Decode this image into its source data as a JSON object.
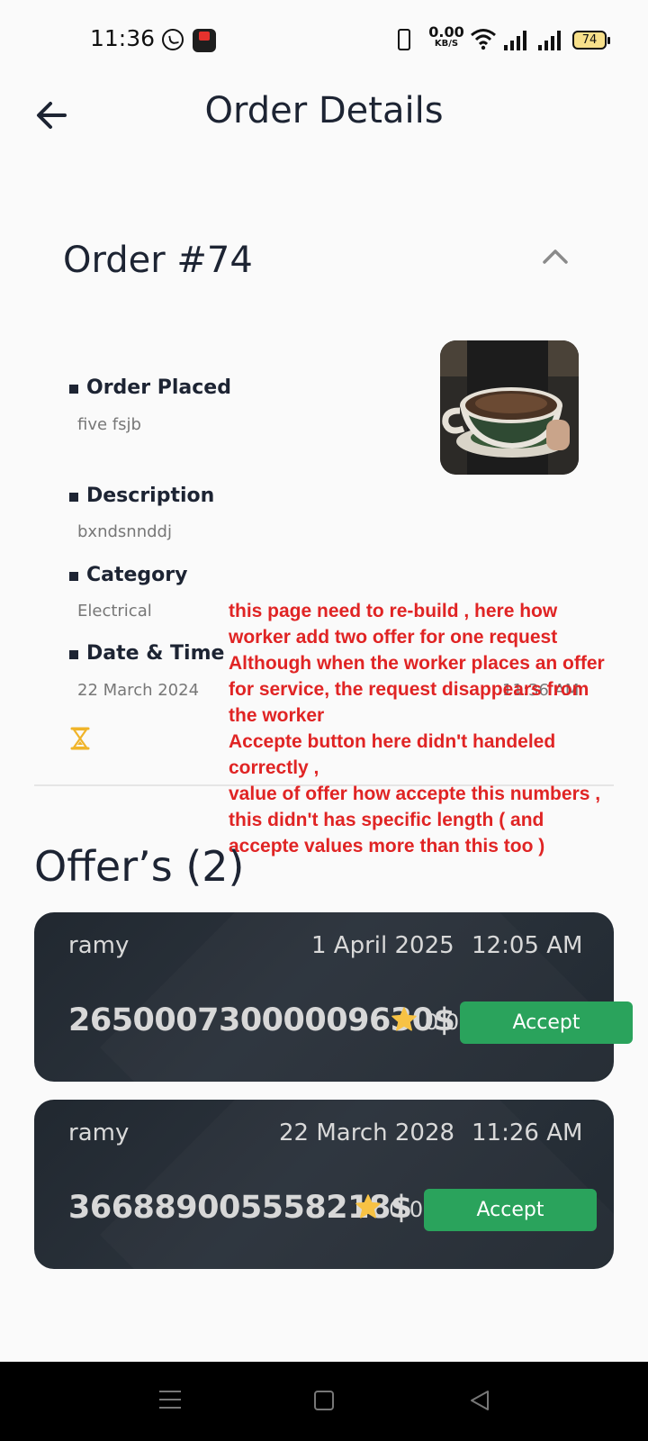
{
  "status_bar": {
    "time": "11:36",
    "net_speed_value": "0.00",
    "net_speed_unit": "KB/S",
    "battery": "74",
    "icons": [
      "whatsapp-icon",
      "app-icon",
      "vibrate-icon",
      "wifi-icon",
      "signal-icon",
      "battery-icon"
    ]
  },
  "header": {
    "title": "Order Details",
    "back_icon": "arrow-left-icon"
  },
  "order": {
    "title": "Order #74",
    "collapse_icon": "chevron-up-icon",
    "details": [
      {
        "label": "Order Placed",
        "value": "five fsjb"
      },
      {
        "label": "Description",
        "value": "bxndsnnddj"
      },
      {
        "label": "Category",
        "value": "Electrical"
      },
      {
        "label": "Date & Time",
        "value": "22 March 2024"
      }
    ],
    "time": "11:36 AM",
    "status_icon": "hourglass-icon"
  },
  "annotation": {
    "lines": [
      "this page need to re-build , here how",
      "worker add two offer for one request",
      "Although when the worker places an offer",
      "for service, the request disappears from",
      "the worker",
      "Accepte button here didn't handeled",
      "correctly ,",
      "value of offer how  accepte this numbers ,",
      "this didn't has specific length  ( and",
      "accepte values  more than this too )"
    ],
    "color": "#e02424"
  },
  "offers": {
    "title": "Offer’s (2)",
    "items": [
      {
        "name": "ramy",
        "date": "1 April 2025",
        "time": "12:05 AM",
        "price": "26500073000009630$",
        "rating": "0.0",
        "accept_label": "Accept"
      },
      {
        "name": "ramy",
        "date": "22 March 2028",
        "time": "11:26 AM",
        "price": "366889005558218$",
        "rating": "0.0",
        "accept_label": "Accept"
      }
    ]
  },
  "colors": {
    "accent_green": "#2aa35c",
    "card_bg": "#242b33",
    "star": "#f7c244",
    "hourglass": "#f0b429"
  },
  "nav_bar": {
    "icons": [
      "menu-icon",
      "home-icon",
      "back-icon"
    ]
  }
}
